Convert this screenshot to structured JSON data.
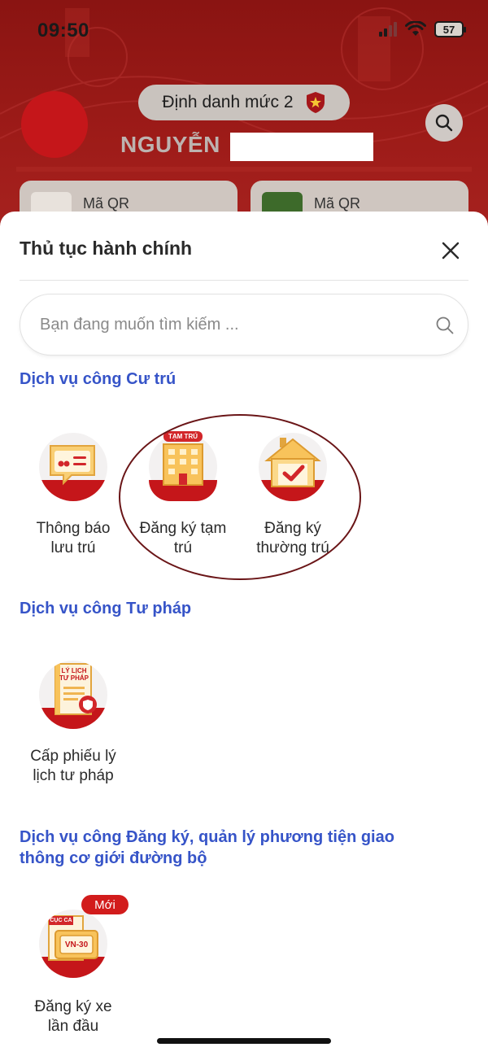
{
  "status_bar": {
    "time": "09:50",
    "battery": "57"
  },
  "profile": {
    "level_label": "Định danh mức 2",
    "name": "NGUYỄN"
  },
  "qr_cards": [
    {
      "label": "Mã QR"
    },
    {
      "label": "Mã QR"
    }
  ],
  "sheet": {
    "title": "Thủ tục hành chính",
    "search_placeholder": "Bạn đang muốn tìm kiếm ..."
  },
  "sections": [
    {
      "title": "Dịch vụ công Cư trú",
      "items": [
        {
          "label_line1": "Thông báo",
          "label_line2": "lưu trú",
          "icon": "notice-icon"
        },
        {
          "label_line1": "Đăng ký tạm",
          "label_line2": "trú",
          "icon": "temporary-residence-building-icon",
          "icon_tag": "TẠM TRÚ"
        },
        {
          "label_line1": "Đăng ký",
          "label_line2": "thường trú",
          "icon": "house-check-icon"
        }
      ]
    },
    {
      "title": "Dịch vụ công Tư pháp",
      "items": [
        {
          "label_line1": "Cấp phiếu lý",
          "label_line2": "lịch tư pháp",
          "icon": "criminal-record-document-icon",
          "icon_text_1": "LÝ LỊCH",
          "icon_text_2": "TƯ PHÁP"
        }
      ]
    },
    {
      "title_line1": "Dịch vụ công Đăng ký, quản lý phương tiện giao",
      "title_line2": "thông cơ giới đường bộ",
      "items": [
        {
          "label_line1": "Đăng ký xe",
          "label_line2": "lần đầu",
          "icon": "vehicle-registration-plate-icon",
          "icon_text_1": "CỤC CA",
          "plate_text": "VN-30",
          "badge": "Mới"
        }
      ]
    }
  ],
  "colors": {
    "header_red": "#9d1b18",
    "accent_blue": "#3654c8",
    "icon_red": "#c5161a",
    "highlight": "#6a1517"
  }
}
